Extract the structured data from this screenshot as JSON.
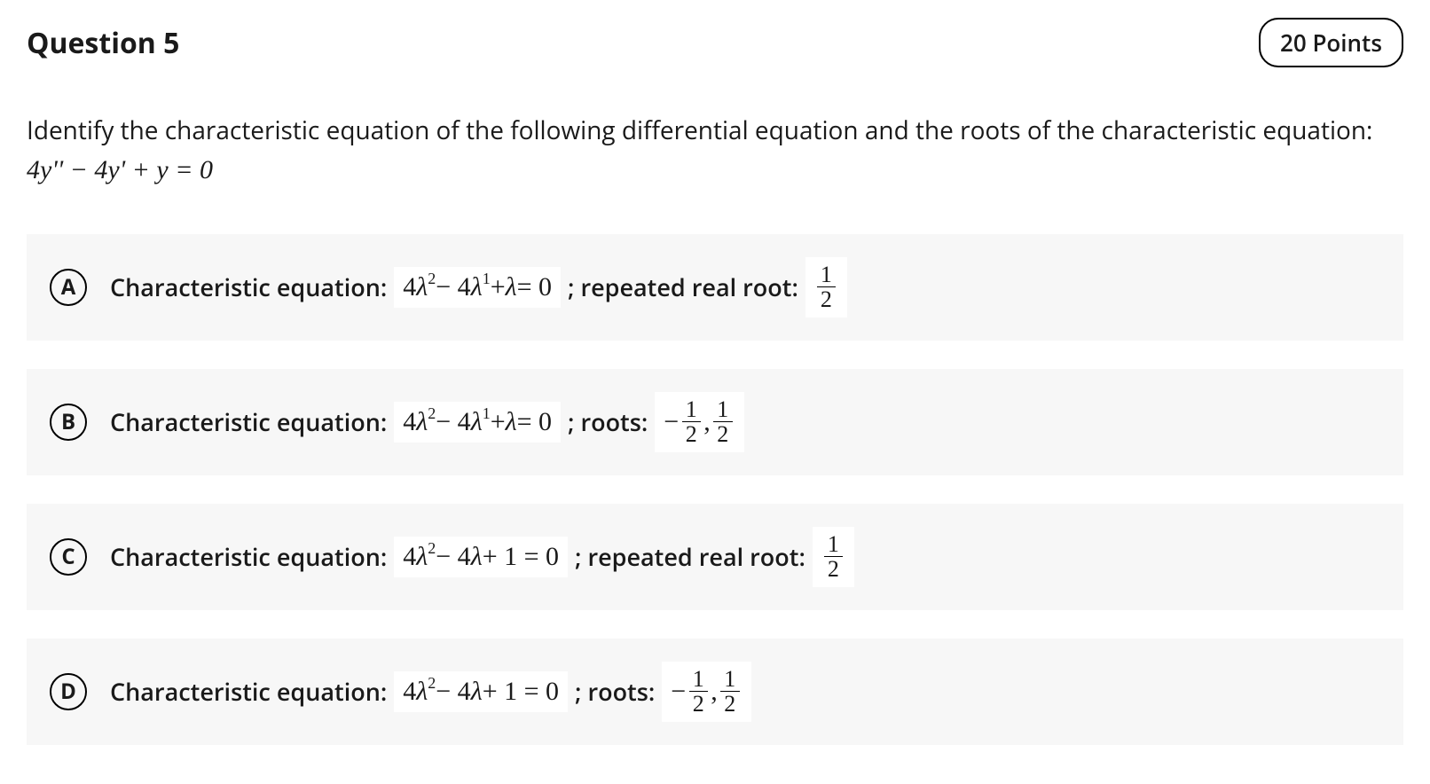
{
  "header": {
    "title": "Question 5",
    "points": "20 Points"
  },
  "prompt": {
    "text": "Identify the characteristic equation of the following differential equation and the roots of the characteristic equation:",
    "equation": "4y'' − 4y' + y = 0"
  },
  "shared": {
    "label_prefix": "Characteristic equation:"
  },
  "options": {
    "A": {
      "letter": "A",
      "equation": "4λ² − 4λ¹ + λ = 0",
      "roots_label": " ; repeated real root:",
      "roots": "1/2"
    },
    "B": {
      "letter": "B",
      "equation": "4λ² − 4λ¹ + λ = 0",
      "roots_label": " ; roots:",
      "roots": "−1/2, 1/2"
    },
    "C": {
      "letter": "C",
      "equation": "4λ² − 4λ + 1 = 0",
      "roots_label": " ; repeated real root:",
      "roots": "1/2"
    },
    "D": {
      "letter": "D",
      "equation": "4λ² − 4λ + 1 = 0",
      "roots_label": " ; roots:",
      "roots": "−1/2, 1/2"
    }
  }
}
